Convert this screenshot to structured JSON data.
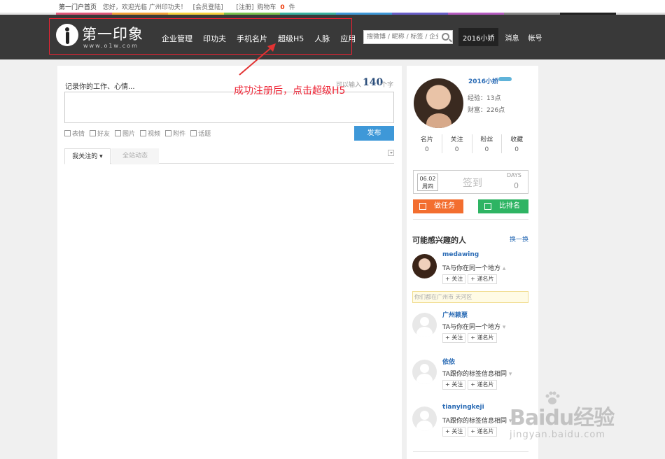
{
  "topbar": {
    "home": "第一门户首页",
    "greeting": "您好，欢迎光临 广州印功夫！",
    "member_login": "[会员登陆]",
    "register": "[注册]",
    "cart_label": "购物车",
    "cart_count": "0",
    "cart_unit": "件"
  },
  "header": {
    "logo_text": "第一印象",
    "logo_url": "www.o1w.com",
    "nav": [
      "企业管理",
      "印功夫",
      "手机名片",
      "超级H5",
      "人脉",
      "应用"
    ],
    "search_placeholder": "搜微博 / 昵称 / 标签 / 企业",
    "username": "2016小娇",
    "messages": "消息",
    "account": "帐号"
  },
  "annotation": {
    "text": "成功注册后，点击超级H5",
    "color": "#e23333"
  },
  "post": {
    "label": "记录你的工作、心情...",
    "count_label": "可以输入",
    "count_value": "140",
    "count_unit": "个字",
    "tools": [
      "表情",
      "好友",
      "图片",
      "视频",
      "附件",
      "话题"
    ],
    "publish": "发布"
  },
  "feed_tabs": [
    "我关注的 ▾",
    "全站动态"
  ],
  "profile": {
    "name": "2016小娇",
    "exp": "经验：13点",
    "wealth": "财富：226点",
    "stats": [
      {
        "label": "名片",
        "value": "0"
      },
      {
        "label": "关注",
        "value": "0"
      },
      {
        "label": "粉丝",
        "value": "0"
      },
      {
        "label": "收藏",
        "value": "0"
      }
    ]
  },
  "signin": {
    "date": "06.02",
    "weekday": "周四",
    "label": "签到",
    "days_label": "DAYS",
    "days_value": "0"
  },
  "actions": {
    "task": "做任务",
    "rank": "比排名"
  },
  "interest": {
    "title": "可能感兴趣的人",
    "refresh": "换一换",
    "people": [
      {
        "name": "medawing",
        "desc": "TA与你在同一个地方",
        "follow": "+ 关注",
        "card": "+ 递名片",
        "location": "你们都在广州市 天河区"
      },
      {
        "name": "广州赖票",
        "desc": "TA与你在同一个地方",
        "follow": "+ 关注",
        "card": "+ 递名片"
      },
      {
        "name": "依依",
        "desc": "TA跟你的标签信息相同",
        "follow": "+ 关注",
        "card": "+ 递名片"
      },
      {
        "name": "tianyingkeji",
        "desc": "TA跟你的标签信息相同",
        "follow": "+ 关注",
        "card": "+ 递名片"
      }
    ]
  },
  "watermark": {
    "main": "Baidu经验",
    "sub": "jingyan.baidu.com"
  },
  "colors": {
    "header_bg": "#393939",
    "publish_btn": "#3e98d8",
    "task_btn": "#f36e2f",
    "rank_btn": "#2eb463",
    "link": "#2a6bb5"
  }
}
